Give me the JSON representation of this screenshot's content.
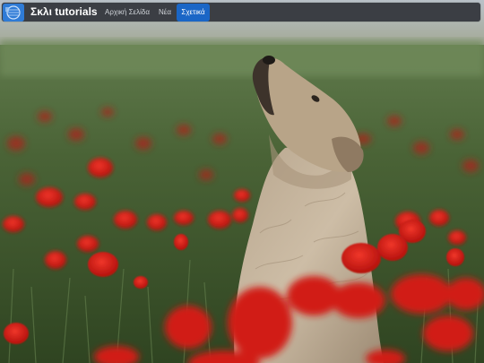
{
  "navbar": {
    "brand": "Σκλι tutorials",
    "items": [
      {
        "label": "Αρχική Σελίδα",
        "active": false
      },
      {
        "label": "Νέα",
        "active": false
      },
      {
        "label": "Σχετικά",
        "active": true
      }
    ]
  },
  "colors": {
    "navbar_bg": "#3b3e44",
    "active_item": "#1a66c6",
    "logo": "#2f7bd6",
    "poppy_red": "#d11a12",
    "field_green": "#3f5a2c",
    "dog_fur": "#c9b79f"
  },
  "hero": {
    "icon": "dog-in-poppy-field-photo"
  }
}
